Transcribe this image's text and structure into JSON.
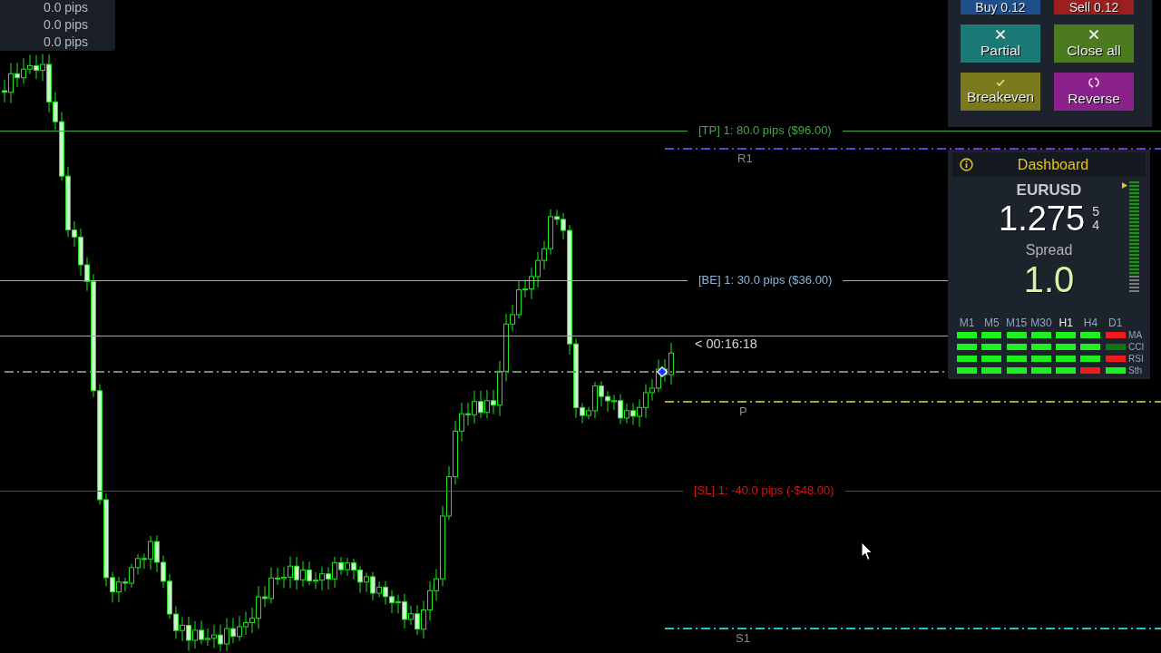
{
  "pips_panel": {
    "values": [
      "0.0 pips",
      "0.0 pips",
      "0.0 pips"
    ]
  },
  "trade_panel": {
    "buttons": [
      {
        "kind": "buy",
        "label": "Buy 0.12"
      },
      {
        "kind": "sell",
        "label": "Sell 0.12"
      },
      {
        "kind": "partial",
        "label": "Partial"
      },
      {
        "kind": "close_all",
        "label": "Close all"
      },
      {
        "kind": "breakeven",
        "label": "Breakeven"
      },
      {
        "kind": "reverse",
        "label": "Reverse"
      }
    ]
  },
  "chart": {
    "levels": [
      {
        "kind": "trade",
        "label": "[TP] 1: 80.0 pips ($96.00)",
        "color": "#44a844"
      },
      {
        "kind": "pivot",
        "label": "R1",
        "color": "#6a3ce0"
      },
      {
        "kind": "trade",
        "label": "[BE] 1: 30.0 pips ($36.00)",
        "color": "#8fb6d8"
      },
      {
        "kind": "timer",
        "label": "< 00:16:18",
        "color": "#a8a8a8"
      },
      {
        "kind": "entry",
        "color": "#6d8a6d"
      },
      {
        "kind": "pivot",
        "label": "P",
        "color": "#a6a630"
      },
      {
        "kind": "trade",
        "label": "[SL] 1: -40.0 pips (-$48.00)",
        "color": "#d81414"
      },
      {
        "kind": "pivot",
        "label": "S1",
        "color": "#22c4c4"
      }
    ]
  },
  "dashboard": {
    "title": "Dashboard",
    "symbol": "EURUSD",
    "price": "1.275",
    "price_digits": [
      "5",
      "4"
    ],
    "spread_label": "Spread",
    "spread": "1.0",
    "meter": {
      "level": 0.85
    },
    "timeframes": [
      {
        "label": "M1",
        "selected": false
      },
      {
        "label": "M5",
        "selected": false
      },
      {
        "label": "M15",
        "selected": false
      },
      {
        "label": "M30",
        "selected": false
      },
      {
        "label": "H1",
        "selected": true
      },
      {
        "label": "H4",
        "selected": false
      },
      {
        "label": "D1",
        "selected": false
      }
    ],
    "indicators": [
      {
        "label": "MA",
        "signals": [
          {
            "color": "#1ef01e"
          },
          {
            "color": "#1ef01e"
          },
          {
            "color": "#1ef01e"
          },
          {
            "color": "#1ef01e"
          },
          {
            "color": "#1ef01e"
          },
          {
            "color": "#1ef01e"
          },
          {
            "color": "#f01c1c"
          }
        ]
      },
      {
        "label": "CCI",
        "signals": [
          {
            "color": "#1ef01e"
          },
          {
            "color": "#1ef01e"
          },
          {
            "color": "#1ef01e"
          },
          {
            "color": "#1ef01e"
          },
          {
            "color": "#1ef01e"
          },
          {
            "color": "#1ef01e"
          },
          {
            "color": "#0b780b"
          }
        ]
      },
      {
        "label": "RSI",
        "signals": [
          {
            "color": "#1ef01e"
          },
          {
            "color": "#1ef01e"
          },
          {
            "color": "#1ef01e"
          },
          {
            "color": "#1ef01e"
          },
          {
            "color": "#1ef01e"
          },
          {
            "color": "#1ef01e"
          },
          {
            "color": "#f01c1c"
          }
        ]
      },
      {
        "label": "Sth",
        "signals": [
          {
            "color": "#1ef01e"
          },
          {
            "color": "#1ef01e"
          },
          {
            "color": "#1ef01e"
          },
          {
            "color": "#1ef01e"
          },
          {
            "color": "#1ef01e"
          },
          {
            "color": "#f01c1c"
          },
          {
            "color": "#1ef01e"
          }
        ]
      }
    ]
  }
}
